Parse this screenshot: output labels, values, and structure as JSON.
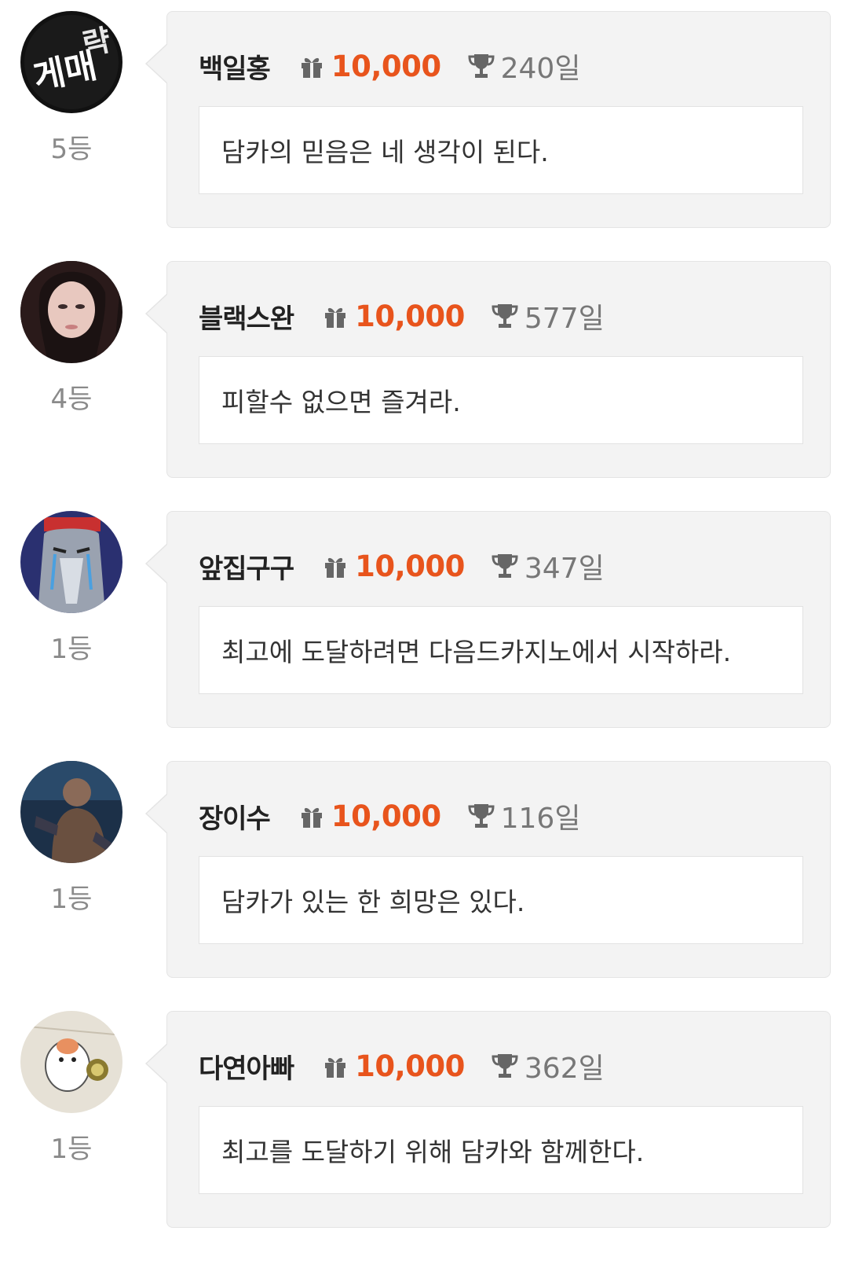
{
  "colors": {
    "amount": "#e8541c",
    "card_bg": "#f3f3f3",
    "rank_text": "#8a8a8a"
  },
  "entries": [
    {
      "avatar": "avatar-neon-sign",
      "rank": "5등",
      "nickname": "백일홍",
      "gift_icon": "gift-icon",
      "amount": "10,000",
      "trophy_icon": "trophy-icon",
      "days": "240일",
      "message": "담카의 믿음은 네 생각이 된다."
    },
    {
      "avatar": "avatar-portrait",
      "rank": "4등",
      "nickname": "블랙스완",
      "gift_icon": "gift-icon",
      "amount": "10,000",
      "trophy_icon": "trophy-icon",
      "days": "577일",
      "message": "피할수 없으면 즐겨라."
    },
    {
      "avatar": "avatar-cartoon",
      "rank": "1등",
      "nickname": "앞집구구",
      "gift_icon": "gift-icon",
      "amount": "10,000",
      "trophy_icon": "trophy-icon",
      "days": "347일",
      "message": "최고에 도달하려면 다음드카지노에서 시작하라."
    },
    {
      "avatar": "avatar-photo",
      "rank": "1등",
      "nickname": "장이수",
      "gift_icon": "gift-icon",
      "amount": "10,000",
      "trophy_icon": "trophy-icon",
      "days": "116일",
      "message": "담카가 있는 한 희망은 있다."
    },
    {
      "avatar": "avatar-hamster",
      "rank": "1등",
      "nickname": "다연아빠",
      "gift_icon": "gift-icon",
      "amount": "10,000",
      "trophy_icon": "trophy-icon",
      "days": "362일",
      "message": "최고를 도달하기 위해 담카와 함께한다."
    }
  ]
}
